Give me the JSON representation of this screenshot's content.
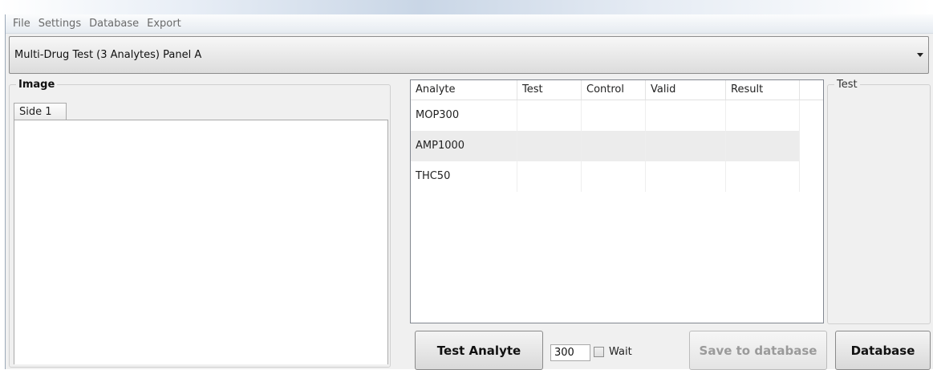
{
  "menu": [
    "File",
    "Settings",
    "Database",
    "Export"
  ],
  "panel_select": {
    "value": "Multi-Drug Test (3 Analytes) Panel A"
  },
  "image_group": {
    "title": "Image",
    "tab": "Side 1"
  },
  "test_group": {
    "title": "Test"
  },
  "grid": {
    "columns": [
      "Analyte",
      "Test",
      "Control",
      "Valid",
      "Result"
    ],
    "rows": [
      [
        "MOP300",
        "",
        "",
        "",
        ""
      ],
      [
        "AMP1000",
        "",
        "",
        "",
        ""
      ],
      [
        "THC50",
        "",
        "",
        "",
        ""
      ]
    ]
  },
  "controls": {
    "test_analyte_label": "Test Analyte",
    "wait_value": "300",
    "wait_label": "Wait",
    "wait_checked": false,
    "save_label": "Save to database",
    "database_label": "Database"
  }
}
